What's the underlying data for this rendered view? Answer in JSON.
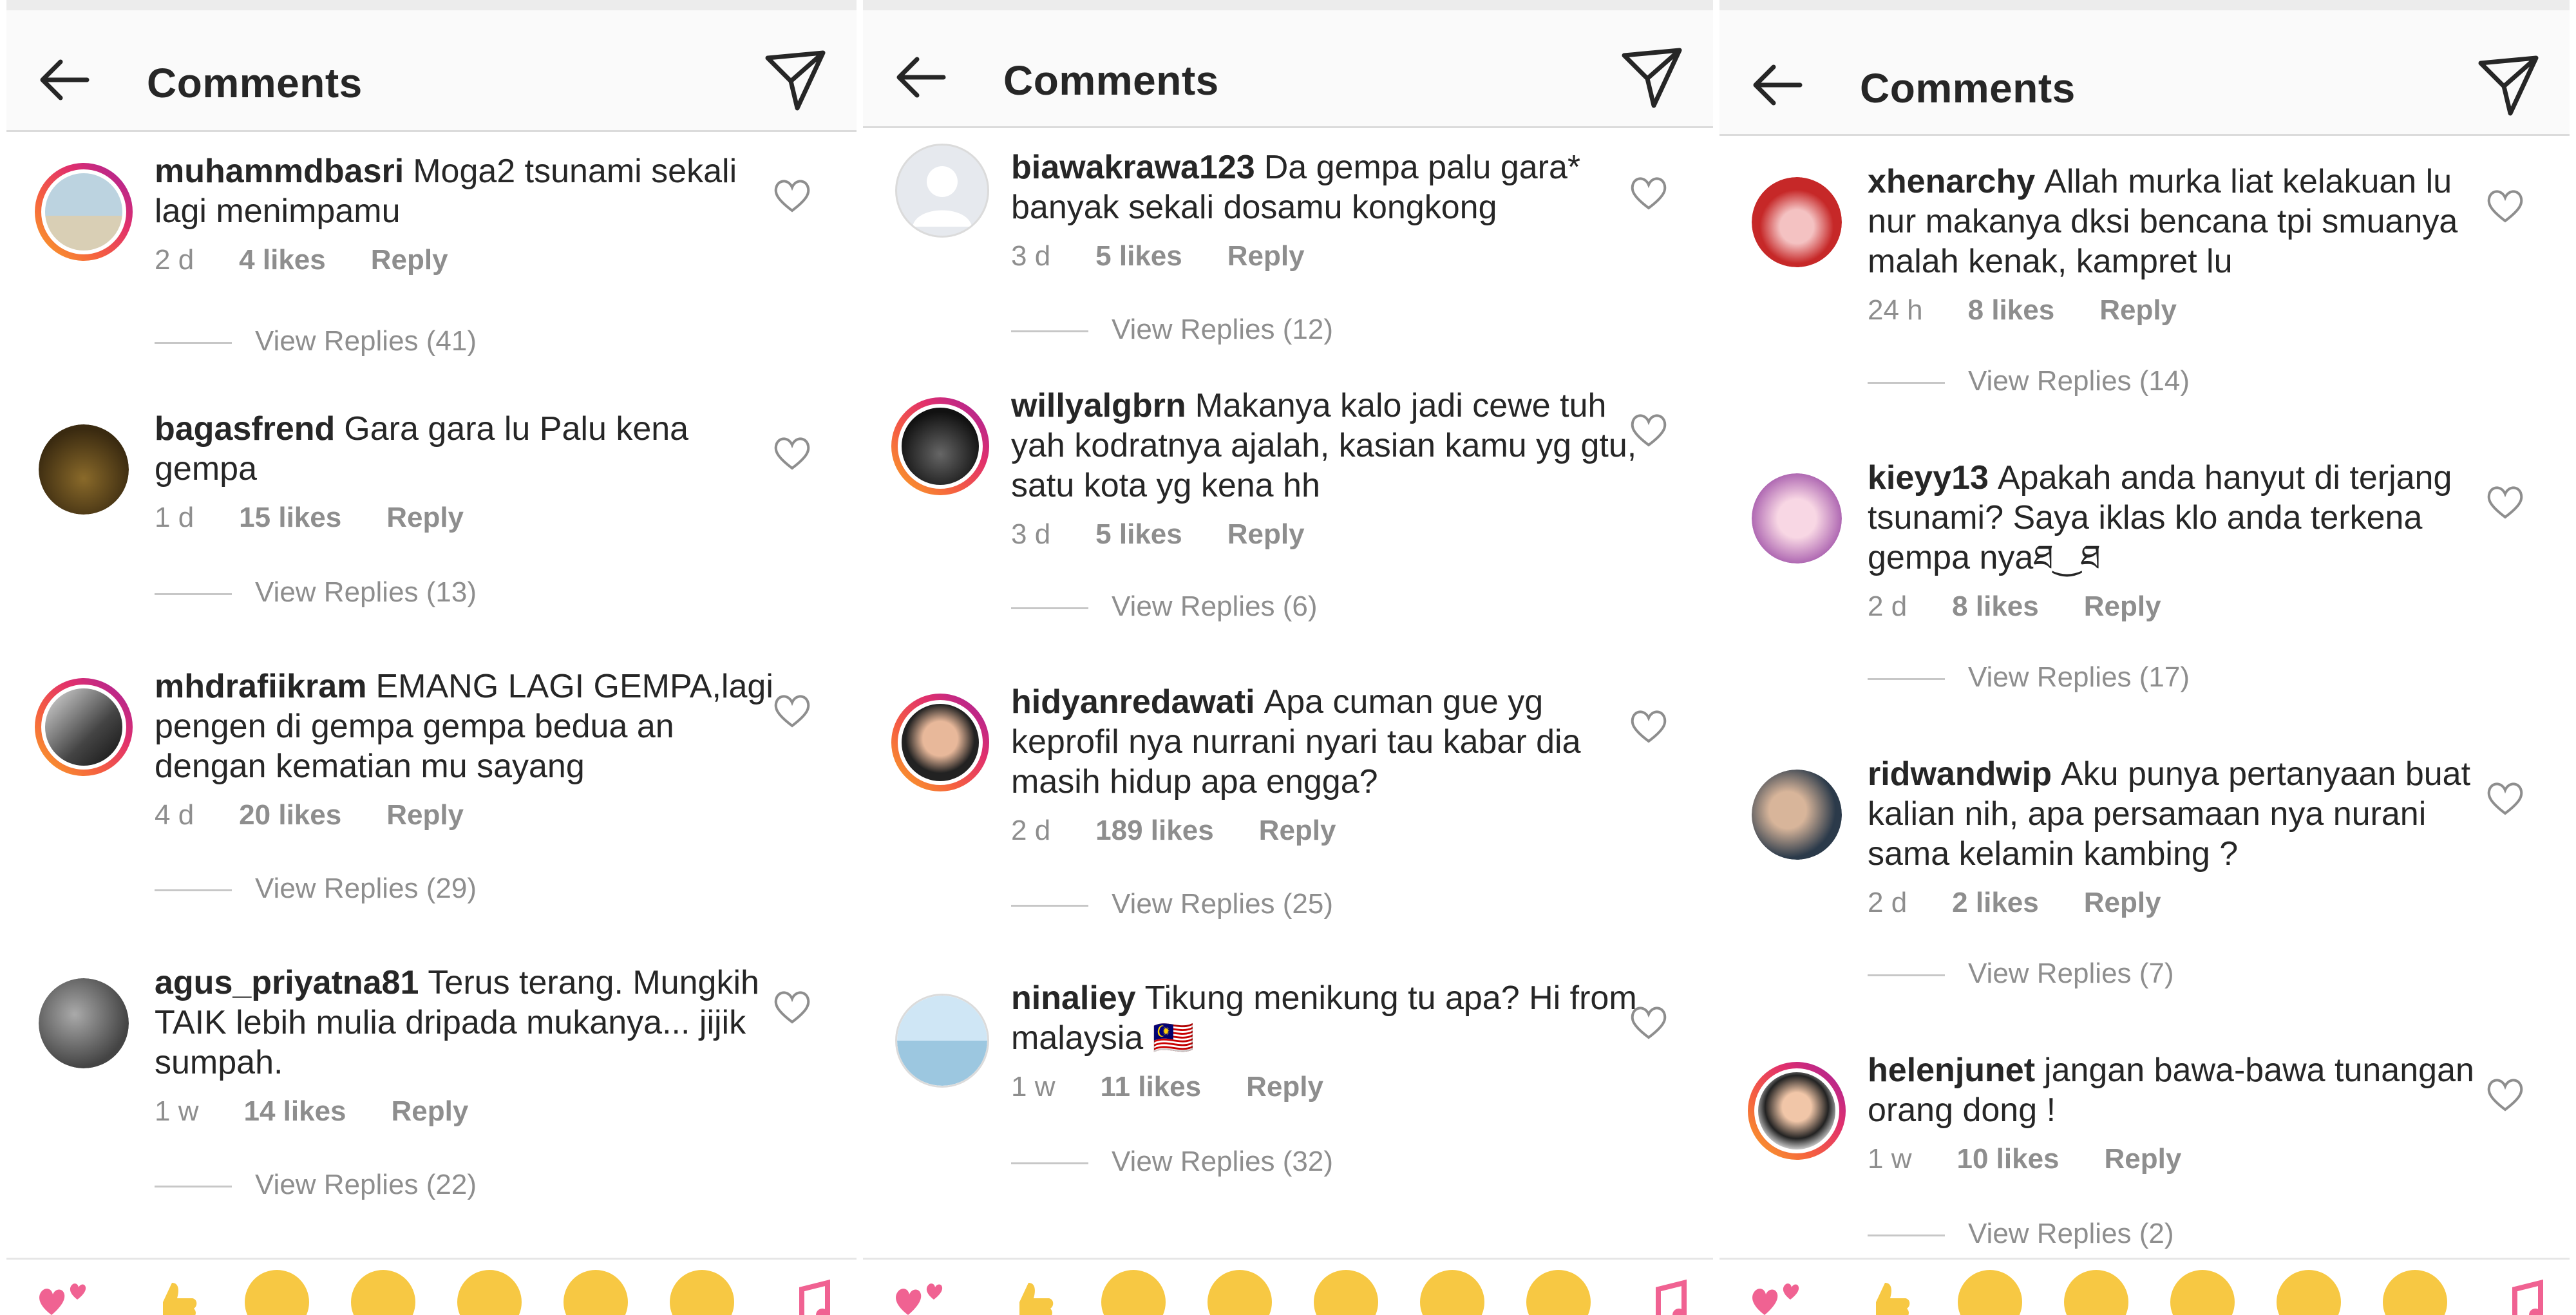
{
  "panels": [
    {
      "title": "Comments",
      "comments": [
        {
          "user": "muhammdbasri",
          "text": "Moga2 tsunami sekali lagi menimpamu",
          "time": "2 d",
          "likes": "4 likes",
          "reply": "Reply",
          "replies": "View Replies (41)"
        },
        {
          "user": "bagasfrend",
          "text": "Gara gara lu Palu kena gempa",
          "time": "1 d",
          "likes": "15 likes",
          "reply": "Reply",
          "replies": "View Replies (13)"
        },
        {
          "user": "mhdrafiikram",
          "text": "EMANG LAGI GEMPA,lagi pengen di gempa gempa bedua an dengan kematian mu sayang",
          "time": "4 d",
          "likes": "20 likes",
          "reply": "Reply",
          "replies": "View Replies (29)"
        },
        {
          "user": "agus_priyatna81",
          "text": "Terus terang. Mungkih TAIK lebih mulia dripada mukanya... jijik sumpah.",
          "time": "1 w",
          "likes": "14 likes",
          "reply": "Reply",
          "replies": "View Replies (22)"
        }
      ]
    },
    {
      "title": "Comments",
      "comments": [
        {
          "user": "biawakrawa123",
          "text": "Da gempa palu gara* banyak sekali dosamu kongkong",
          "time": "3 d",
          "likes": "5 likes",
          "reply": "Reply",
          "replies": "View Replies (12)"
        },
        {
          "user": "willyalgbrn",
          "text": "Makanya kalo jadi cewe tuh yah kodratnya ajalah, kasian kamu yg gtu, satu kota yg kena hh",
          "time": "3 d",
          "likes": "5 likes",
          "reply": "Reply",
          "replies": "View Replies (6)"
        },
        {
          "user": "hidyanredawati",
          "text": "Apa cuman gue yg keprofil nya nurrani nyari tau kabar dia masih hidup apa engga?",
          "time": "2 d",
          "likes": "189 likes",
          "reply": "Reply",
          "replies": "View Replies (25)"
        },
        {
          "user": "ninaliey",
          "text": "Tikung menikung tu apa? Hi from malaysia 🇲🇾",
          "time": "1 w",
          "likes": "11 likes",
          "reply": "Reply",
          "replies": "View Replies (32)"
        }
      ]
    },
    {
      "title": "Comments",
      "comments": [
        {
          "user": "xhenarchy",
          "text": "Allah murka liat kelakuan lu nur makanya dksi bencana tpi smuanya malah kenak, kampret lu",
          "time": "24 h",
          "likes": "8 likes",
          "reply": "Reply",
          "replies": "View Replies (14)"
        },
        {
          "user": "kieyy13",
          "text": "Apakah anda hanyut di terjang tsunami? Saya iklas klo anda terkena gempa nyaཐ‿ཐ",
          "time": "2 d",
          "likes": "8 likes",
          "reply": "Reply",
          "replies": "View Replies (17)"
        },
        {
          "user": "ridwandwip",
          "text": "Aku punya pertanyaan buat kalian nih, apa persamaan nya nurani sama kelamin kambing ?",
          "time": "2 d",
          "likes": "2 likes",
          "reply": "Reply",
          "replies": "View Replies (7)"
        },
        {
          "user": "helenjunet",
          "text": "jangan bawa-bawa tunangan orang dong !",
          "time": "1 w",
          "likes": "10 likes",
          "reply": "Reply",
          "replies": "View Replies (2)"
        }
      ]
    }
  ],
  "colors": {
    "text": "#262626",
    "meta": "#8e8e8e",
    "header_bg": "#fafafa",
    "ring": "#e1306c"
  },
  "icons": [
    "back-arrow-icon",
    "send-icon",
    "heart-icon",
    "emoji-icon"
  ]
}
